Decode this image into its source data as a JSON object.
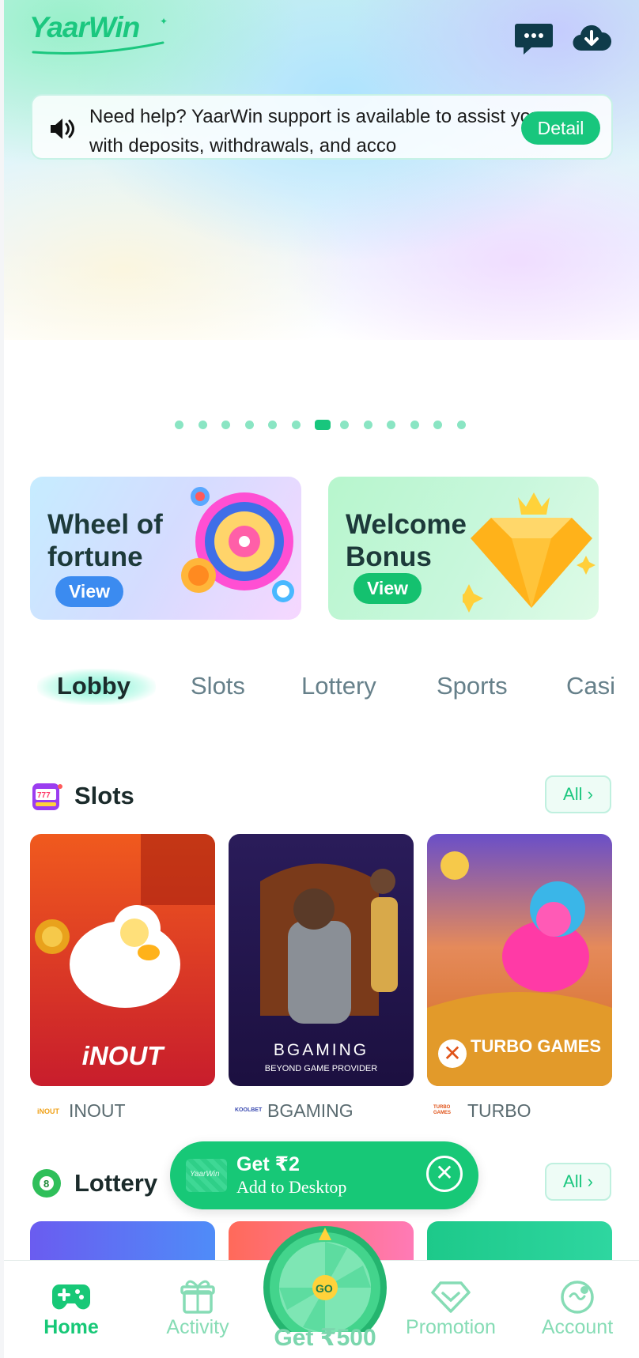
{
  "header": {
    "logo_text": "YaarWin",
    "icons": [
      "chat-icon",
      "download-icon"
    ]
  },
  "notice": {
    "text": "Need help? YaarWin support is available to assist you with deposits, withdrawals, and acco",
    "button": "Detail"
  },
  "carousel": {
    "dot_count": 13,
    "active_index": 6
  },
  "promos": [
    {
      "title": "Wheel of fortune",
      "button": "View"
    },
    {
      "title": "Welcome Bonus",
      "button": "View"
    }
  ],
  "tabs": [
    "Lobby",
    "Slots",
    "Lottery",
    "Sports",
    "Casi"
  ],
  "slots": {
    "title": "Slots",
    "all_label": "All ›",
    "games": [
      {
        "art_text": "iNOUT",
        "logo": "iNOUT",
        "name": "INOUT"
      },
      {
        "art_text": "BGAMING",
        "art_sub": "BEYOND GAME PROVIDER",
        "logo": "KOOLBET",
        "name": "BGAMING"
      },
      {
        "art_text": "TURBO GAMES",
        "logo": "TURBO GAMES",
        "name": "TURBO"
      }
    ]
  },
  "lottery": {
    "title": "Lottery",
    "all_label": "All ›"
  },
  "toast": {
    "logo": "YaarWin",
    "line1": "Get ₹2",
    "line2": "Add to Desktop",
    "close": "✕"
  },
  "nav": {
    "items": [
      "Home",
      "Activity",
      "Promotion",
      "Account"
    ],
    "active": "Home",
    "wheel_go": "GO",
    "wheel_label": "Get ₹500"
  },
  "colors": {
    "brand": "#17c877",
    "blue": "#3b8bf0",
    "text": "#1b2b2b"
  }
}
